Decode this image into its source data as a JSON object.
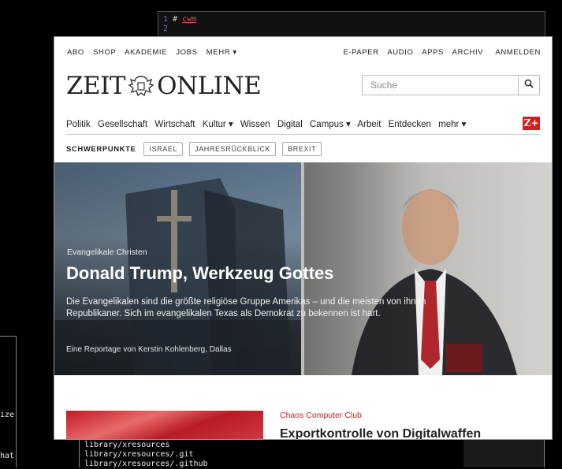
{
  "terminal_top": {
    "gutter": [
      "1",
      "2"
    ],
    "line1_hash": "#",
    "line1_word": "cwm"
  },
  "terminal_left": {
    "frag1": "ize",
    "frag2": "hat"
  },
  "terminal_bottom": {
    "lines": [
      "library/xresources",
      "library/xresources/.git",
      "library/xresources/.github"
    ]
  },
  "topnav": {
    "left": [
      "ABO",
      "SHOP",
      "AKADEMIE",
      "JOBS",
      "MEHR ▾"
    ],
    "right": [
      "E-PAPER",
      "AUDIO",
      "APPS",
      "ARCHIV",
      "ANMELDEN"
    ]
  },
  "logo": {
    "left": "ZEIT",
    "right": "ONLINE"
  },
  "search": {
    "placeholder": "Suche"
  },
  "mainnav": [
    "Politik",
    "Gesellschaft",
    "Wirtschaft",
    "Kultur ▾",
    "Wissen",
    "Digital",
    "Campus ▾",
    "Arbeit",
    "Entdecken",
    "mehr ▾"
  ],
  "zplus": "Z+",
  "schwerpunkte": {
    "label": "SCHWERPUNKTE",
    "tags": [
      "ISRAEL",
      "JAHRESRÜCKBLICK",
      "BREXIT"
    ]
  },
  "hero": {
    "kicker": "Evangelikale Christen",
    "headline": "Donald Trump, Werkzeug Gottes",
    "teaser": "Die Evangelikalen sind die größte religiöse Gruppe Amerikas – und die meisten von ihnen Republikaner. Sich im evangelikalen Texas als Demokrat zu bekennen ist hart.",
    "byline": "Eine Reportage von Kerstin Kohlenberg, Dallas"
  },
  "card": {
    "kicker": "Chaos Computer Club",
    "title": "Exportkontrolle von Digitalwaffen"
  },
  "colors": {
    "accent": "#c41e1e",
    "zplus_bg": "#d21e1e"
  }
}
